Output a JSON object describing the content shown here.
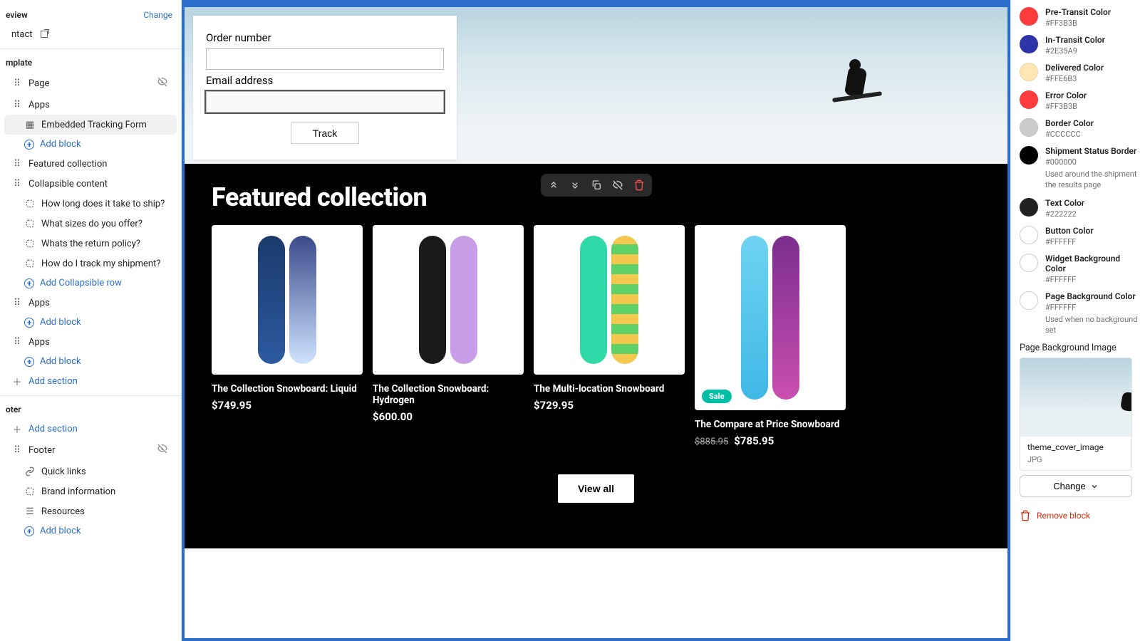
{
  "sidebar": {
    "preview": {
      "title": "eview",
      "contact": "ntact",
      "change": "Change"
    },
    "template": {
      "title": "mplate",
      "page": "Page",
      "apps1": "Apps",
      "embedded": "Embedded Tracking Form",
      "add_block1": "Add block",
      "featured": "Featured collection",
      "collapsible": "Collapsible content",
      "faq1": "How long does it take to ship?",
      "faq2": "What sizes do you offer?",
      "faq3": "Whats the return policy?",
      "faq4": "How do I track my shipment?",
      "add_collapsible": "Add Collapsible row",
      "apps2": "Apps",
      "add_block2": "Add block",
      "apps3": "Apps",
      "add_block3": "Add block",
      "add_section1": "Add section"
    },
    "footer": {
      "title": "oter",
      "add_section2": "Add section",
      "footer": "Footer",
      "quick_links": "Quick links",
      "brand_info": "Brand information",
      "resources": "Resources",
      "add_block4": "Add block"
    }
  },
  "form": {
    "order_label": "Order number",
    "email_label": "Email address",
    "track_btn": "Track"
  },
  "featured": {
    "heading": "Featured collection",
    "viewall": "View all",
    "products": [
      {
        "title": "The Collection Snowboard: Liquid",
        "price": "$749.95"
      },
      {
        "title": "The Collection Snowboard: Hydrogen",
        "price": "$600.00"
      },
      {
        "title": "The Multi-location Snowboard",
        "price": "$729.95"
      },
      {
        "title": "The Compare at Price Snowboard",
        "strike": "$885.95",
        "price": "$785.95",
        "sale": "Sale"
      }
    ]
  },
  "inspector": {
    "colors": [
      {
        "name": "Pre-Transit Color",
        "hex": "#FF3B3B",
        "swatch": "#ff3b3b"
      },
      {
        "name": "In-Transit Color",
        "hex": "#2E35A9",
        "swatch": "#2e35a9"
      },
      {
        "name": "Delivered Color",
        "hex": "#FFE6B3",
        "swatch": "#ffe6b3"
      },
      {
        "name": "Error Color",
        "hex": "#FF3B3B",
        "swatch": "#ff3b3b"
      },
      {
        "name": "Border Color",
        "hex": "#CCCCCC",
        "swatch": "#cccccc"
      },
      {
        "name": "Shipment Status Border",
        "hex": "#000000",
        "swatch": "#000000",
        "desc": "Used around the shipment the results page"
      },
      {
        "name": "Text Color",
        "hex": "#222222",
        "swatch": "#222222"
      },
      {
        "name": "Button Color",
        "hex": "#FFFFFF",
        "swatch": "#ffffff",
        "outline": true
      },
      {
        "name": "Widget Background Color",
        "hex": "#FFFFFF",
        "swatch": "#ffffff",
        "outline": true
      },
      {
        "name": "Page Background Color",
        "hex": "#FFFFFF",
        "swatch": "#ffffff",
        "outline": true,
        "desc": "Used when no background set"
      }
    ],
    "bg_label": "Page Background Image",
    "bg_filename": "theme_cover_image",
    "bg_type": "JPG",
    "change": "Change",
    "remove": "Remove block"
  }
}
